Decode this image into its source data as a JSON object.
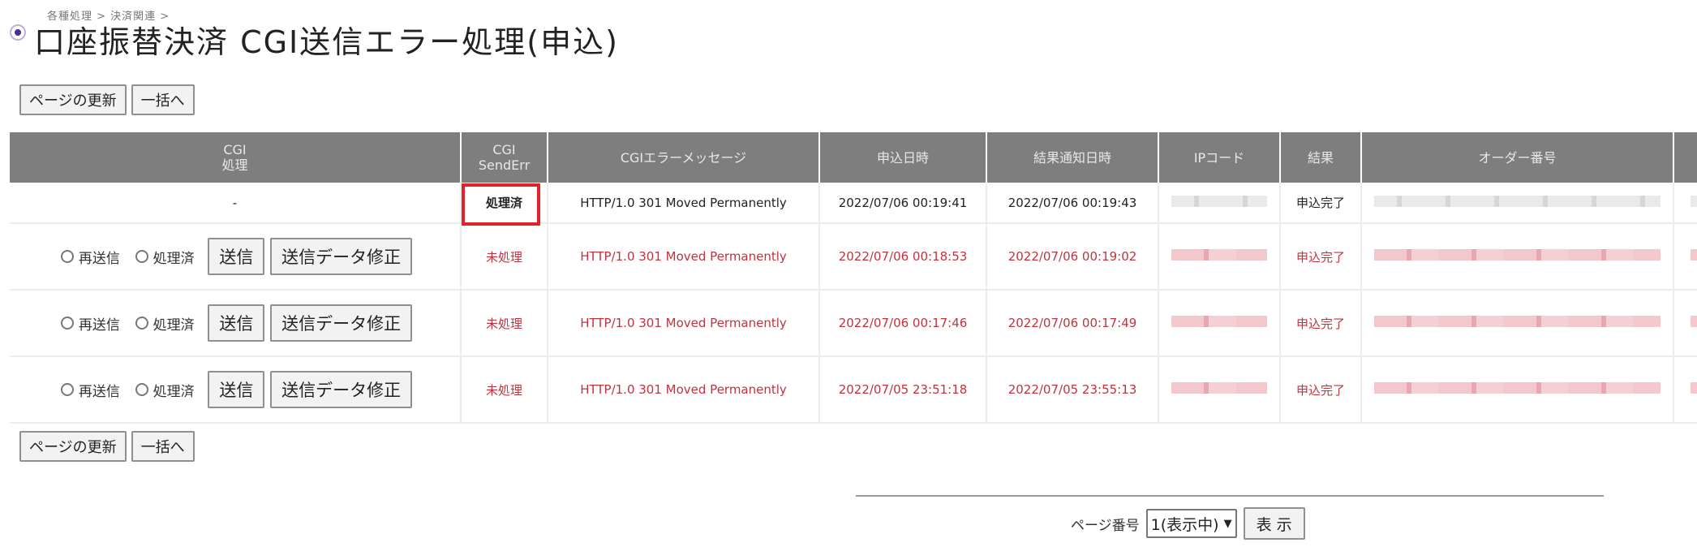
{
  "breadcrumb": "各種処理 > 決済関連 >",
  "title": "口座振替決済 CGI送信エラー処理(申込)",
  "toolbar": {
    "refresh_label": "ページの更新",
    "bulk_label": "一括へ"
  },
  "table": {
    "headers": {
      "cgi_process": "CGI\n処理",
      "cgi_senderr": "CGI\nSendErr",
      "error_message": "CGIエラーメッセージ",
      "applied_at": "申込日時",
      "notified_at": "結果通知日時",
      "ip_code": "IPコード",
      "result": "結果",
      "order_no": "オーダー番号"
    },
    "rows": [
      {
        "cgi_process": "-",
        "senderr": "処理済",
        "error_message": "HTTP/1.0 301 Moved Permanently",
        "applied_at": "2022/07/06 00:19:41",
        "notified_at": "2022/07/06 00:19:43",
        "result": "申込完了"
      },
      {
        "resend_label": "再送信",
        "processed_label": "処理済",
        "send_label": "送信",
        "edit_label": "送信データ修正",
        "senderr": "未処理",
        "error_message": "HTTP/1.0 301 Moved Permanently",
        "applied_at": "2022/07/06 00:18:53",
        "notified_at": "2022/07/06 00:19:02",
        "result": "申込完了"
      },
      {
        "resend_label": "再送信",
        "processed_label": "処理済",
        "send_label": "送信",
        "edit_label": "送信データ修正",
        "senderr": "未処理",
        "error_message": "HTTP/1.0 301 Moved Permanently",
        "applied_at": "2022/07/06 00:17:46",
        "notified_at": "2022/07/06 00:17:49",
        "result": "申込完了"
      },
      {
        "resend_label": "再送信",
        "processed_label": "処理済",
        "send_label": "送信",
        "edit_label": "送信データ修正",
        "senderr": "未処理",
        "error_message": "HTTP/1.0 301 Moved Permanently",
        "applied_at": "2022/07/05 23:51:18",
        "notified_at": "2022/07/05 23:55:13",
        "result": "申込完了"
      }
    ]
  },
  "pager": {
    "label": "ページ番号",
    "selected": "1(表示中)",
    "show_label": "表 示"
  },
  "colors": {
    "header_bg": "#7e7e7e",
    "error_text": "#c0333d",
    "highlight": "#e0232a"
  }
}
